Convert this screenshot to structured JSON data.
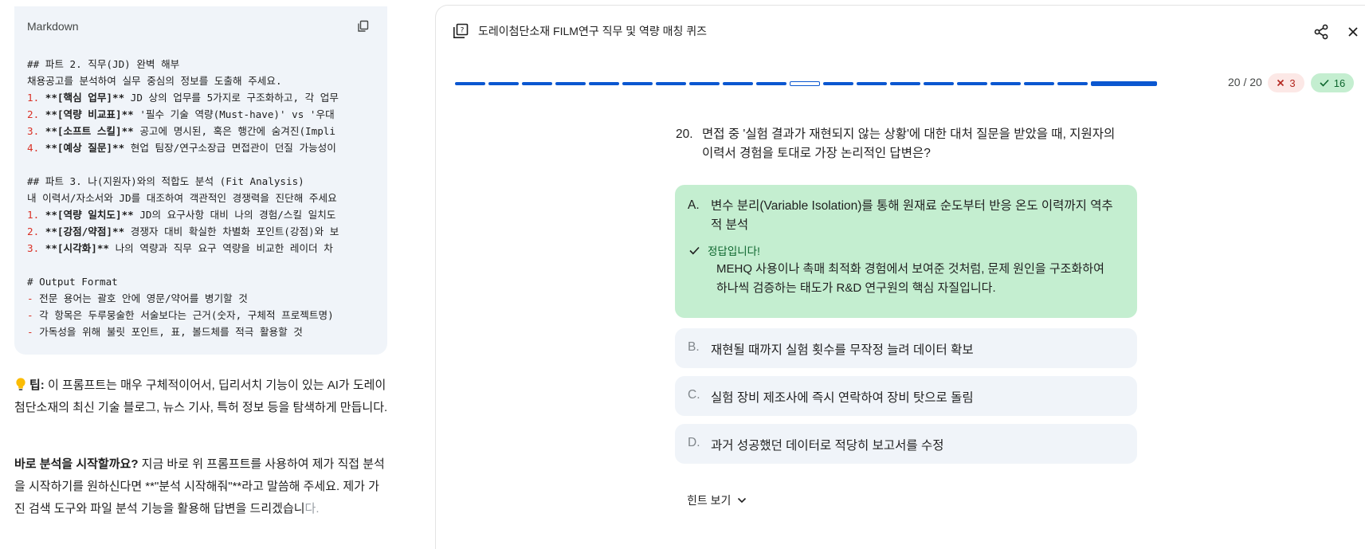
{
  "code_block": {
    "language": "Markdown",
    "copy_icon": "copy-icon",
    "lines": [
      {
        "prefix": "",
        "bold": "",
        "text": "## 파트 2. 직무(JD) 완벽 해부"
      },
      {
        "prefix": "",
        "bold": "",
        "text": "채용공고를 분석하여 실무 중심의 정보를 도출해 주세요."
      },
      {
        "prefix": "1. ",
        "bold": "**[핵심 업무]**",
        "text": " JD 상의 업무를 5가지로 구조화하고, 각 업무"
      },
      {
        "prefix": "2. ",
        "bold": "**[역량 비교표]**",
        "text": " '필수 기술 역량(Must-have)' vs '우대"
      },
      {
        "prefix": "3. ",
        "bold": "**[소프트 스킬]**",
        "text": " 공고에 명시된, 혹은 행간에 숨겨진(Impli"
      },
      {
        "prefix": "4. ",
        "bold": "**[예상 질문]**",
        "text": " 현업 팀장/연구소장급 면접관이 던질 가능성이"
      },
      {
        "prefix": "",
        "bold": "",
        "text": ""
      },
      {
        "prefix": "",
        "bold": "",
        "text": "## 파트 3. 나(지원자)와의 적합도 분석 (Fit Analysis)"
      },
      {
        "prefix": "",
        "bold": "",
        "text": "내 이력서/자소서와 JD를 대조하여 객관적인 경쟁력을 진단해 주세요"
      },
      {
        "prefix": "1. ",
        "bold": "**[역량 일치도]**",
        "text": " JD의 요구사항 대비 나의 경험/스킬 일치도"
      },
      {
        "prefix": "2. ",
        "bold": "**[강점/약점]**",
        "text": " 경쟁자 대비 확실한 차별화 포인트(강점)와 보"
      },
      {
        "prefix": "3. ",
        "bold": "**[시각화]**",
        "text": " 나의 역량과 직무 요구 역량을 비교한 레이더 차"
      },
      {
        "prefix": "",
        "bold": "",
        "text": ""
      },
      {
        "prefix": "",
        "bold": "",
        "text": "# Output Format"
      },
      {
        "prefix": "- ",
        "bold": "",
        "text": "전문 용어는 괄호 안에 영문/약어를 병기할 것"
      },
      {
        "prefix": "- ",
        "bold": "",
        "text": "각 항목은 두루뭉술한 서술보다는 근거(숫자, 구체적 프로젝트명)"
      },
      {
        "prefix": "- ",
        "bold": "",
        "text": "가독성을 위해 불릿 포인트, 표, 볼드체를 적극 활용할 것"
      }
    ]
  },
  "tip": {
    "icon": "lightbulb-icon",
    "label": "팁:",
    "text": " 이 프롬프트는 매우 구체적이어서, 딥리서치 기능이 있는 AI가 도레이첨단소재의 최신 기술 블로그, 뉴스 기사, 특허 정보 등을 탐색하게 만듭니다."
  },
  "cta": {
    "label": "바로 분석을 시작할까요?",
    "text": " 지금 바로 위 프롬프트를 사용하여 제가 직접 분석을 시작하기를 원하신다면 **\"분석 시작해줘\"**라고 말씀해 주세요. 제가 가진 검색 도구와 파일 분석 기능을 활용해 답변을 드리겠습니",
    "faded": "다."
  },
  "quiz": {
    "title": "도레이첨단소재 FILM연구 직무 및 역량 매칭 퀴즈",
    "icons": {
      "quiz": "quiz-icon",
      "share": "share-icon",
      "close": "close-icon",
      "wrong": "x-icon",
      "right": "check-icon",
      "hint": "chevron-down-icon"
    },
    "progress": {
      "current": 20,
      "total": 20,
      "counter_text": "20 / 20",
      "current_segment_index": 10,
      "segment_count": 20
    },
    "wrong_count": "3",
    "right_count": "16",
    "question_number": "20.",
    "question": "면접 중 '실험 결과가 재현되지 않는 상황'에 대한 대처 질문을 받았을 때, 지원자의 이력서 경험을 토대로 가장 논리적인 답변은?",
    "options": [
      {
        "letter": "A.",
        "text": "변수 분리(Variable Isolation)를 통해 원재료 순도부터 반응 온도 이력까지 역추적 분석",
        "selected": true
      },
      {
        "letter": "B.",
        "text": "재현될 때까지 실험 횟수를 무작정 늘려 데이터 확보",
        "selected": false
      },
      {
        "letter": "C.",
        "text": "실험 장비 제조사에 즉시 연락하여 장비 탓으로 돌림",
        "selected": false
      },
      {
        "letter": "D.",
        "text": "과거 성공했던 데이터로 적당히 보고서를 수정",
        "selected": false
      }
    ],
    "feedback": {
      "label": "정답입니다!",
      "explanation": "MEHQ 사용이나 촉매 최적화 경험에서 보여준 것처럼, 문제 원인을 구조화하여 하나씩 검증하는 태도가 R&D 연구원의 핵심 자질입니다."
    },
    "hint_label": "힌트 보기"
  },
  "colors": {
    "accent": "#0b57d0",
    "correct_bg": "#c4eed0",
    "correct_text": "#0d652d",
    "wrong_bg": "#fce8e6",
    "wrong_text": "#b3261e",
    "option_bg": "#f0f4f9",
    "code_bg": "#f0f4f9",
    "code_number": "#d93025"
  }
}
